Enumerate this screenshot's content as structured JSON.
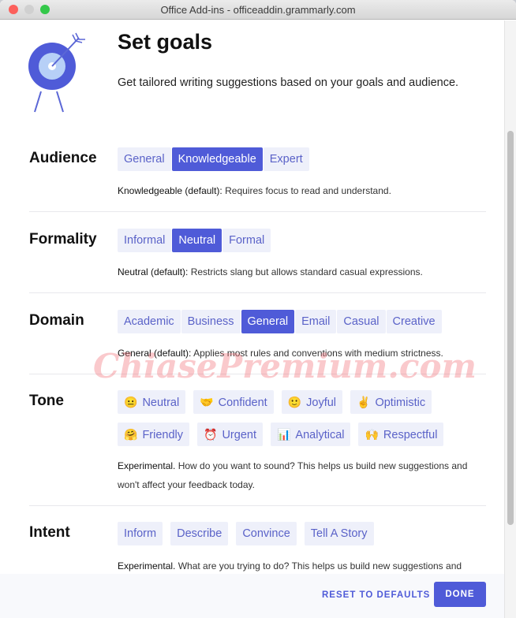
{
  "window": {
    "title": "Office Add-ins - officeaddin.grammarly.com"
  },
  "header": {
    "title": "Set goals",
    "subtitle": "Get tailored writing suggestions based on your goals and audience."
  },
  "colors": {
    "accent": "#4f5bd8",
    "option_bg": "#eef0fa",
    "option_text": "#5a62c8"
  },
  "sections": [
    {
      "label": "Audience",
      "options": [
        {
          "label": "General"
        },
        {
          "label": "Knowledgeable",
          "selected": true
        },
        {
          "label": "Expert"
        }
      ],
      "desc_bold": "Knowledgeable (default):",
      "desc": " Requires focus to read and understand."
    },
    {
      "label": "Formality",
      "options": [
        {
          "label": "Informal"
        },
        {
          "label": "Neutral",
          "selected": true
        },
        {
          "label": "Formal"
        }
      ],
      "desc_bold": "Neutral (default):",
      "desc": " Restricts slang but allows standard casual expressions."
    },
    {
      "label": "Domain",
      "options": [
        {
          "label": "Academic"
        },
        {
          "label": "Business"
        },
        {
          "label": "General",
          "selected": true
        },
        {
          "label": "Email"
        },
        {
          "label": "Casual"
        },
        {
          "label": "Creative"
        }
      ],
      "desc_bold": "General (default):",
      "desc": " Applies most rules and conventions with medium strictness."
    },
    {
      "label": "Tone",
      "options": [
        {
          "label": "Neutral",
          "emoji": "😐"
        },
        {
          "label": "Confident",
          "emoji": "🤝"
        },
        {
          "label": "Joyful",
          "emoji": "🙂"
        },
        {
          "label": "Optimistic",
          "emoji": "✌️"
        },
        {
          "label": "Friendly",
          "emoji": "🤗"
        },
        {
          "label": "Urgent",
          "emoji": "⏰"
        },
        {
          "label": "Analytical",
          "emoji": "📊"
        },
        {
          "label": "Respectful",
          "emoji": "🙌"
        }
      ],
      "desc_bold": "Experimental.",
      "desc": " How do you want to sound? This helps us build new suggestions and won't affect your feedback today."
    },
    {
      "label": "Intent",
      "options": [
        {
          "label": "Inform"
        },
        {
          "label": "Describe"
        },
        {
          "label": "Convince"
        },
        {
          "label": "Tell A Story"
        }
      ],
      "desc_bold": "Experimental.",
      "desc": " What are you trying to do? This helps us build new suggestions and"
    }
  ],
  "footer": {
    "reset_label": "RESET TO DEFAULTS",
    "done_label": "DONE"
  },
  "watermark": "ChiasePremium.com"
}
